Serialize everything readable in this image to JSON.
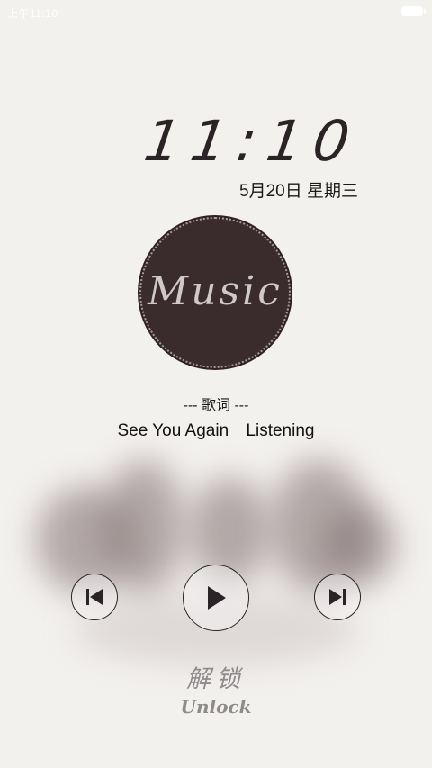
{
  "status_bar": {
    "time": "上午11:10"
  },
  "lock": {
    "time": "11:10",
    "date": "5月20日 星期三"
  },
  "disc": {
    "label": "Music"
  },
  "lyrics": {
    "heading": "--- 歌词 ---"
  },
  "song": {
    "title": "See You Again",
    "state": "Listening"
  },
  "controls": {
    "prev": "previous-track",
    "play": "play",
    "next": "next-track"
  },
  "unlock": {
    "cn": "解锁",
    "en": "Unlock"
  },
  "colors": {
    "background": "#f3f1ee",
    "disc": "#3a2b2c",
    "text": "#1e1a1b",
    "unlock": "#8f8a8b"
  }
}
